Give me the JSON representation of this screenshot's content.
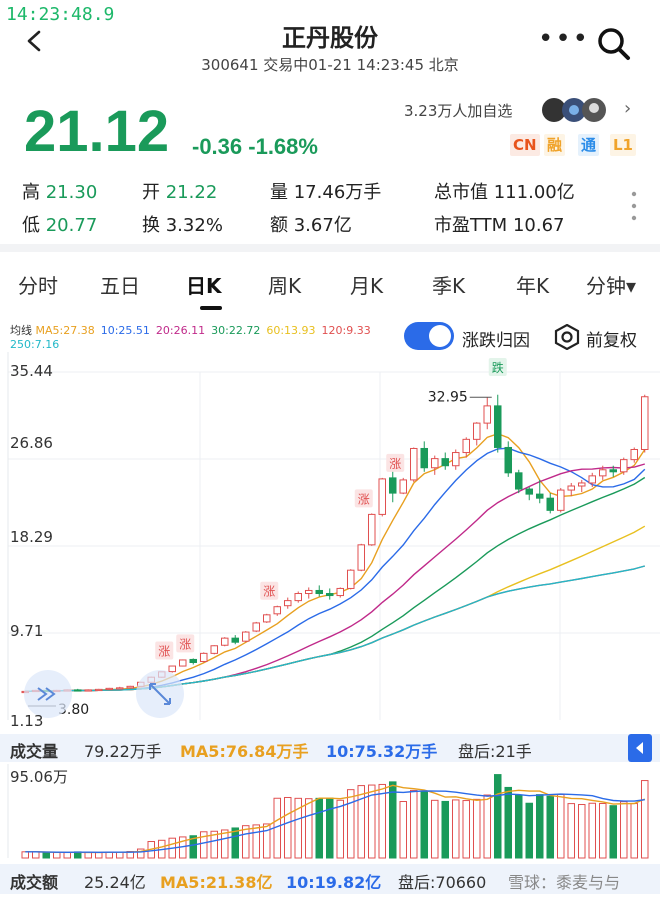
{
  "status": {
    "clock": "14:23:48.9"
  },
  "header": {
    "title": "正丹股份",
    "subtitle": "300641 交易中01-21 14:23:45 北京"
  },
  "quote": {
    "price": "21.12",
    "change": "-0.36 -1.68%",
    "watchers": "3.23万人加自选",
    "tags": [
      {
        "label": "CN",
        "color": "#e8541c"
      },
      {
        "label": "融",
        "color": "#f0a32a"
      },
      {
        "label": "通",
        "color": "#2b8ce8"
      },
      {
        "label": "L1",
        "color": "#f0a32a"
      }
    ],
    "stats": {
      "high_label": "高",
      "high": "21.30",
      "open_label": "开",
      "open": "21.22",
      "vol_label": "量",
      "vol": "17.46万手",
      "mcap_label": "总市值",
      "mcap": "111.00亿",
      "low_label": "低",
      "low": "20.77",
      "turn_label": "换",
      "turn": "3.32%",
      "amt_label": "额",
      "amt": "3.67亿",
      "pe_label": "市盈TTM",
      "pe": "10.67"
    }
  },
  "tabs": [
    "分时",
    "五日",
    "日K",
    "周K",
    "月K",
    "季K",
    "年K",
    "分钟▾"
  ],
  "ma": {
    "label": "均线",
    "items": [
      {
        "text": "MA5:27.38",
        "color": "#e8a020"
      },
      {
        "text": "10:25.51",
        "color": "#2b6be8"
      },
      {
        "text": "20:26.11",
        "color": "#c02a8a"
      },
      {
        "text": "30:22.72",
        "color": "#1a9a5a"
      },
      {
        "text": "60:13.93",
        "color": "#e8c020"
      },
      {
        "text": "120:9.33",
        "color": "#e05050"
      },
      {
        "text": "250:7.16",
        "color": "#22b8c8"
      }
    ]
  },
  "controls": {
    "toggle_label": "涨跌归因",
    "fq_label": "前复权"
  },
  "price_axis": [
    "35.44",
    "26.86",
    "18.29",
    "9.71",
    "1.13"
  ],
  "annotations": {
    "high": "32.95",
    "low": "3.80",
    "fall_tag": "跌",
    "rise_tag": "涨"
  },
  "volume": {
    "label": "成交量",
    "value": "79.22万手",
    "ma5": "MA5:76.84万手",
    "ma10": "10:75.32万手",
    "after": "盘后:21手",
    "axis_max": "95.06万"
  },
  "amount": {
    "label": "成交额",
    "value": "25.24亿",
    "ma5": "MA5:21.38亿",
    "ma10": "10:19.82亿",
    "after": "盘后:70660",
    "watermark": "雪球：黍麦与与"
  },
  "colors": {
    "up": "#e05050",
    "down": "#1a9a5a",
    "accent": "#2b6be8"
  },
  "candles": [
    [
      3.9,
      4.0,
      3.8,
      3.95
    ],
    [
      3.95,
      4.1,
      3.9,
      4.05
    ],
    [
      4.05,
      4.1,
      3.95,
      4.0
    ],
    [
      4.0,
      4.1,
      3.95,
      4.05
    ],
    [
      4.05,
      4.15,
      4.0,
      4.1
    ],
    [
      4.1,
      4.2,
      4.0,
      4.05
    ],
    [
      4.05,
      4.15,
      4.0,
      4.1
    ],
    [
      4.1,
      4.2,
      4.05,
      4.15
    ],
    [
      4.15,
      4.3,
      4.1,
      4.25
    ],
    [
      4.25,
      4.4,
      4.2,
      4.3
    ],
    [
      4.3,
      4.5,
      4.25,
      4.45
    ],
    [
      4.45,
      4.9,
      4.4,
      4.85
    ],
    [
      4.85,
      5.4,
      4.8,
      5.35
    ],
    [
      5.35,
      5.9,
      5.3,
      5.88
    ],
    [
      5.9,
      6.5,
      5.8,
      6.45
    ],
    [
      6.45,
      7.1,
      6.4,
      7.05
    ],
    [
      7.1,
      7.2,
      6.6,
      6.8
    ],
    [
      6.9,
      7.8,
      6.8,
      7.7
    ],
    [
      7.7,
      8.5,
      7.6,
      8.45
    ],
    [
      8.5,
      9.3,
      8.4,
      9.2
    ],
    [
      9.2,
      9.5,
      8.6,
      8.8
    ],
    [
      8.9,
      9.9,
      8.8,
      9.8
    ],
    [
      9.9,
      10.8,
      9.8,
      10.7
    ],
    [
      10.8,
      11.6,
      10.7,
      11.5
    ],
    [
      11.6,
      12.4,
      11.4,
      12.3
    ],
    [
      12.4,
      13.2,
      12.1,
      12.9
    ],
    [
      12.9,
      13.8,
      12.7,
      13.6
    ],
    [
      13.6,
      14.2,
      13.1,
      13.9
    ],
    [
      13.9,
      14.4,
      13.3,
      13.6
    ],
    [
      13.6,
      14.1,
      13.0,
      13.4
    ],
    [
      13.4,
      14.2,
      13.2,
      14.1
    ],
    [
      14.1,
      16.0,
      14.0,
      15.9
    ],
    [
      15.9,
      18.5,
      15.8,
      18.4
    ],
    [
      18.4,
      21.5,
      18.3,
      21.4
    ],
    [
      21.4,
      25.0,
      21.2,
      24.9
    ],
    [
      25.0,
      26.5,
      22.6,
      23.5
    ],
    [
      23.5,
      25.0,
      23.4,
      24.8
    ],
    [
      24.8,
      28.0,
      24.6,
      27.9
    ],
    [
      27.9,
      28.6,
      25.6,
      26.0
    ],
    [
      26.0,
      27.2,
      25.3,
      26.9
    ],
    [
      26.9,
      27.5,
      25.8,
      26.2
    ],
    [
      26.2,
      27.8,
      25.8,
      27.5
    ],
    [
      27.5,
      29.0,
      27.0,
      28.8
    ],
    [
      28.8,
      30.5,
      28.2,
      30.4
    ],
    [
      30.4,
      32.95,
      29.8,
      32.1
    ],
    [
      32.1,
      33.2,
      27.5,
      28.0
    ],
    [
      28.0,
      28.6,
      25.1,
      25.5
    ],
    [
      25.5,
      25.8,
      23.5,
      23.9
    ],
    [
      23.9,
      24.1,
      22.8,
      23.4
    ],
    [
      23.4,
      24.8,
      22.5,
      23.0
    ],
    [
      23.0,
      23.5,
      21.5,
      21.8
    ],
    [
      21.8,
      24.0,
      21.6,
      23.8
    ],
    [
      23.8,
      24.5,
      23.2,
      24.2
    ],
    [
      24.2,
      24.8,
      23.6,
      24.5
    ],
    [
      24.5,
      25.5,
      24.1,
      25.2
    ],
    [
      25.2,
      26.2,
      24.8,
      25.8
    ],
    [
      25.8,
      26.2,
      25.1,
      25.6
    ],
    [
      25.6,
      27.0,
      25.3,
      26.8
    ],
    [
      26.8,
      28.0,
      26.5,
      27.8
    ],
    [
      27.8,
      33.2,
      27.5,
      33.0
    ]
  ]
}
